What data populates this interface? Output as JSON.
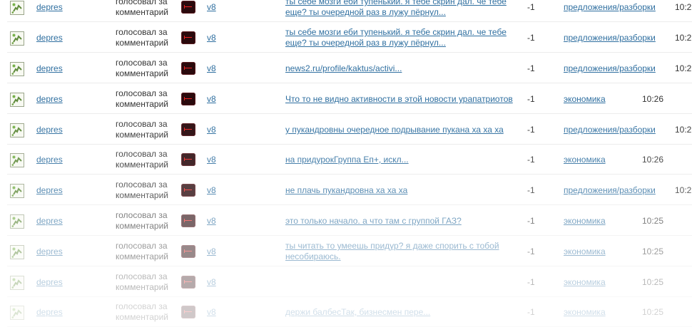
{
  "feed": {
    "rows": [
      {
        "user": "depres",
        "action": "голосовал за комментарий",
        "version": "v8",
        "comment": "ты себе мозги еби тупенький. я тебе скрин дал. че тебе еще? ты очередной раз в лужу пёрнул...",
        "score": "-1",
        "category": "предложения/разборки",
        "time": "10:2"
      },
      {
        "user": "depres",
        "action": "голосовал за комментарий",
        "version": "v8",
        "comment": "ты себе мозги еби тупенький. я тебе скрин дал. че тебе еще? ты очередной раз в лужу пёрнул...",
        "score": "-1",
        "category": "предложения/разборки",
        "time": "10:2"
      },
      {
        "user": "depres",
        "action": "голосовал за комментарий",
        "version": "v8",
        "comment": "news2.ru/profile/kaktus/activi...",
        "score": "-1",
        "category": "предложения/разборки",
        "time": "10:2"
      },
      {
        "user": "depres",
        "action": "голосовал за комментарий",
        "version": "v8",
        "comment": "Что то не видно активности в этой новости урапатриотов",
        "score": "-1",
        "category": "экономика",
        "time": "10:26"
      },
      {
        "user": "depres",
        "action": "голосовал за комментарий",
        "version": "v8",
        "comment": "у пукандровны очередное подрывание пукана ха ха ха",
        "score": "-1",
        "category": "предложения/разборки",
        "time": "10:2"
      },
      {
        "user": "depres",
        "action": "голосовал за комментарий",
        "version": "v8",
        "comment": "на придурокГруппа Еп+, искл...",
        "score": "-1",
        "category": "экономика",
        "time": "10:26"
      },
      {
        "user": "depres",
        "action": "голосовал за комментарий",
        "version": "v8",
        "comment": "не плачь пукандровна ха ха ха",
        "score": "-1",
        "category": "предложения/разборки",
        "time": "10:2"
      },
      {
        "user": "depres",
        "action": "голосовал за комментарий",
        "version": "v8",
        "comment": "это только начало. а что там с группой ГАЗ?",
        "score": "-1",
        "category": "экономика",
        "time": "10:25"
      },
      {
        "user": "depres",
        "action": "голосовал за комментарий",
        "version": "v8",
        "comment": "ты читать то умеешь придур? я даже спорить с тобой несобираюсь.",
        "score": "-1",
        "category": "экономика",
        "time": "10:25"
      },
      {
        "user": "depres",
        "action": "голосовал за комментарий",
        "version": "v8",
        "comment": "",
        "score": "-1",
        "category": "экономика",
        "time": "10:25"
      },
      {
        "user": "depres",
        "action": "голосовал за комментарий",
        "version": "v8",
        "comment": "держи балбесТак, бизнесмен пере...",
        "score": "-1",
        "category": "экономика",
        "time": "10:25"
      }
    ]
  }
}
